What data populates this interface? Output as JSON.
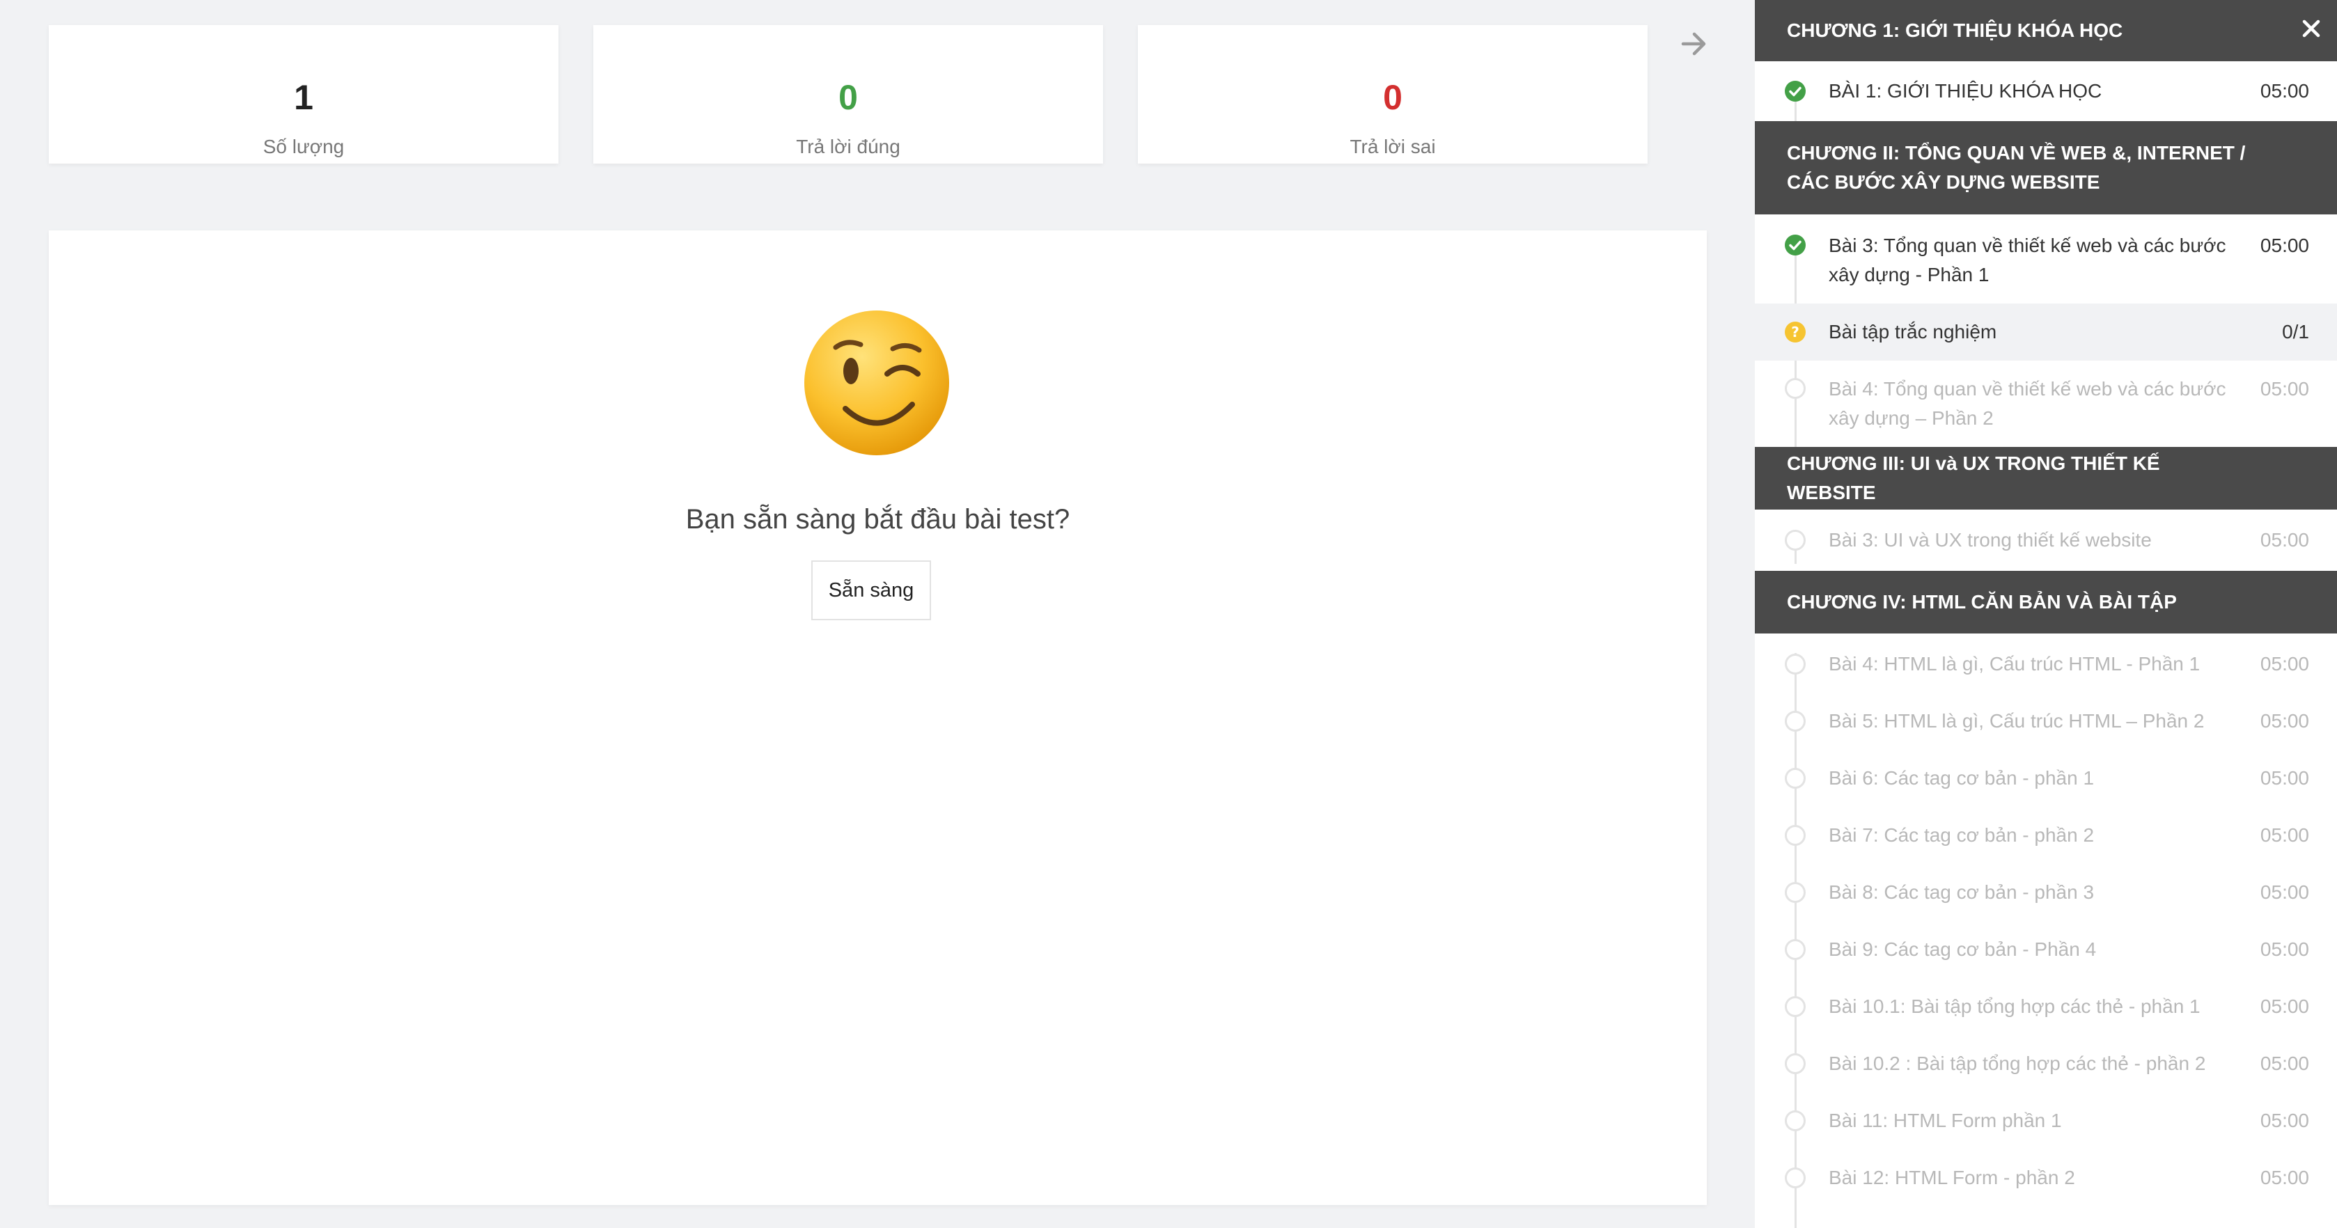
{
  "stats": {
    "total": {
      "value": "1",
      "label": "Số lượng"
    },
    "correct": {
      "value": "0",
      "label": "Trả lời đúng"
    },
    "wrong": {
      "value": "0",
      "label": "Trả lời sai"
    }
  },
  "main": {
    "emoji": "winking-face",
    "prompt": "Bạn sẵn sàng bắt đầu bài test?",
    "ready_button": "Sẵn sàng"
  },
  "sidebar": {
    "chapters": [
      {
        "title": "CHƯƠNG 1: GIỚI THIỆU KHÓA HỌC",
        "lessons": [
          {
            "title": "BÀI 1: GIỚI THIỆU KHÓA HỌC",
            "duration": "05:00",
            "status": "done"
          }
        ]
      },
      {
        "title": "CHƯƠNG II: TỔNG QUAN VỀ WEB &, INTERNET / CÁC BƯỚC XÂY DỰNG WEBSITE",
        "lessons": [
          {
            "title": "Bài 3: Tổng quan về thiết kế web và các bước xây dựng - Phần 1",
            "duration": "05:00",
            "status": "done"
          },
          {
            "title": "Bài tập trắc nghiệm",
            "duration": "0/1",
            "status": "quiz"
          },
          {
            "title": "Bài 4: Tổng quan về thiết kế web và các bước xây dựng – Phần 2",
            "duration": "05:00",
            "status": "pending"
          }
        ]
      },
      {
        "title": "CHƯƠNG III: UI và UX TRONG THIẾT KẾ WEBSITE",
        "lessons": [
          {
            "title": "Bài 3: UI và UX trong thiết kế website",
            "duration": "05:00",
            "status": "pending"
          }
        ]
      },
      {
        "title": "CHƯƠNG IV: HTML CĂN BẢN VÀ BÀI TẬP",
        "lessons": [
          {
            "title": "Bài 4: HTML là gì, Cấu trúc HTML - Phần 1",
            "duration": "05:00",
            "status": "pending"
          },
          {
            "title": "Bài 5: HTML là gì, Cấu trúc HTML – Phần 2",
            "duration": "05:00",
            "status": "pending"
          },
          {
            "title": "Bài 6: Các tag cơ bản - phần 1",
            "duration": "05:00",
            "status": "pending"
          },
          {
            "title": "Bài 7: Các tag cơ bản - phần 2",
            "duration": "05:00",
            "status": "pending"
          },
          {
            "title": "Bài 8: Các tag cơ bản - phần 3",
            "duration": "05:00",
            "status": "pending"
          },
          {
            "title": "Bài 9: Các tag cơ bản - Phần 4",
            "duration": "05:00",
            "status": "pending"
          },
          {
            "title": "Bài 10.1: Bài tập tổng hợp các thẻ - phần 1",
            "duration": "05:00",
            "status": "pending"
          },
          {
            "title": "Bài 10.2 : Bài tập tổng hợp các thẻ - phần 2",
            "duration": "05:00",
            "status": "pending"
          },
          {
            "title": "Bài 11: HTML Form phần 1",
            "duration": "05:00",
            "status": "pending"
          },
          {
            "title": "Bài 12: HTML Form - phần 2",
            "duration": "05:00",
            "status": "pending"
          }
        ]
      }
    ]
  },
  "colors": {
    "correct": "#43a047",
    "wrong": "#d32f2f",
    "chapter_bg": "#4a4a4a",
    "quiz_icon": "#f6c431",
    "done_icon": "#43a047"
  }
}
